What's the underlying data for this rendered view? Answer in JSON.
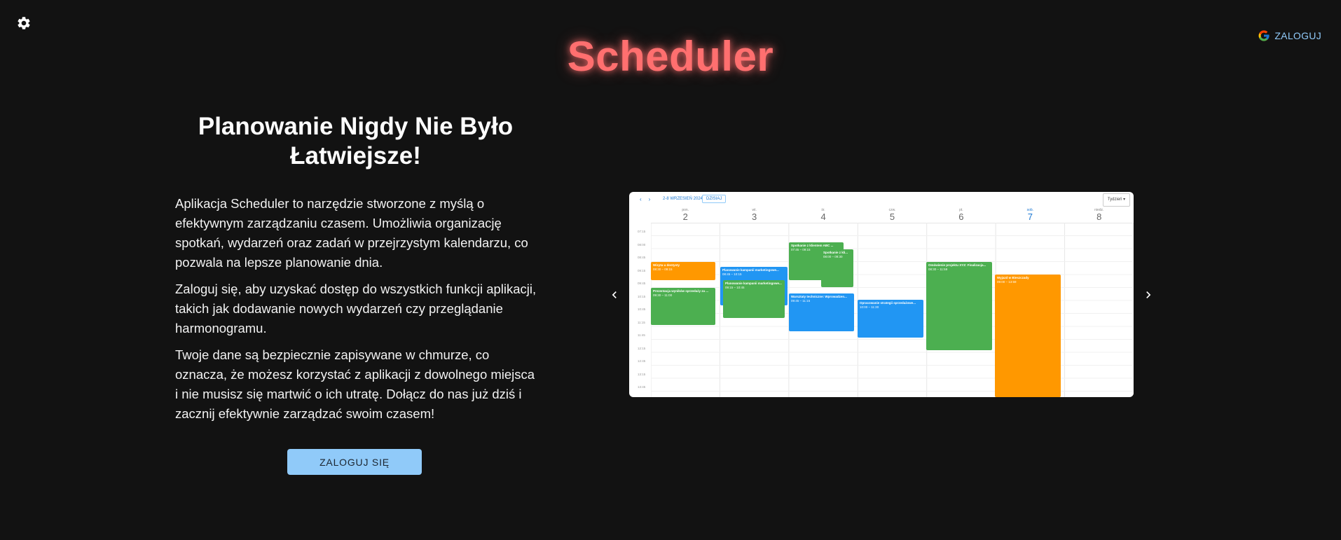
{
  "header": {
    "title": "Scheduler",
    "login_label": "ZALOGUJ",
    "settings_icon": "gear-icon",
    "google_icon": "google-icon"
  },
  "hero": {
    "headline_line1": "Planowanie Nigdy Nie Było",
    "headline_line2": "Łatwiejsze!",
    "paragraphs": [
      "Aplikacja Scheduler to narzędzie stworzone z myślą o efektywnym zarządzaniu czasem. Umożliwia organizację spotkań, wydarzeń oraz zadań w przejrzystym kalendarzu, co pozwala na lepsze planowanie dnia.",
      "Zaloguj się, aby uzyskać dostęp do wszystkich funkcji aplikacji, takich jak dodawanie nowych wydarzeń czy przeglądanie harmonogramu.",
      "Twoje dane są bezpiecznie zapisywane w chmurze, co oznacza, że możesz korzystać z aplikacji z dowolnego miejsca i nie musisz się martwić o ich utratę. Dołącz do nas już dziś i zacznij efektywnie zarządzać swoim czasem!"
    ],
    "login_button": "ZALOGUJ SIĘ"
  },
  "carousel": {
    "prev_icon": "chevron-left-icon",
    "next_icon": "chevron-right-icon",
    "preview": {
      "range_label": "2-8 WRZESIEŃ 2024",
      "today_label": "DZISIAJ",
      "view_label": "Tydzień",
      "days": [
        {
          "name": "pon.",
          "num": "2"
        },
        {
          "name": "wt.",
          "num": "3"
        },
        {
          "name": "śr.",
          "num": "4"
        },
        {
          "name": "czw.",
          "num": "5"
        },
        {
          "name": "pt.",
          "num": "6"
        },
        {
          "name": "sob.",
          "num": "7",
          "active": true
        },
        {
          "name": "niedz.",
          "num": "8"
        }
      ],
      "times": [
        "07:15",
        "08:00",
        "08:45",
        "09:15",
        "09:45",
        "10:15",
        "10:45",
        "11:15",
        "11:45",
        "12:15",
        "12:45",
        "13:15",
        "13:45"
      ],
      "colors": {
        "orange": "#ff9800",
        "green": "#4caf50",
        "blue": "#2196f3"
      },
      "events": [
        {
          "title": "Wizyta u dentysty",
          "time": "08:30 – 09:15",
          "color": "orange"
        },
        {
          "title": "Prezentacja wyników sprzedaży za ...",
          "time": "09:30 – 11:00",
          "color": "green"
        },
        {
          "title": "Planowanie kampanii marketingowe...",
          "time": "08:45 – 10:15",
          "color": "blue"
        },
        {
          "title": "Planowanie kampanii marketingowe...",
          "time": "09:15 – 10:45",
          "color": "green"
        },
        {
          "title": "Spotkanie z klientem ABC ...",
          "time": "07:45 – 09:15",
          "color": "green"
        },
        {
          "title": "Spotkanie z kli...",
          "time": "08:00 – 09:30",
          "color": "green"
        },
        {
          "title": "Warsztaty techniczne: Wprowadzen...",
          "time": "09:45 – 11:15",
          "color": "blue"
        },
        {
          "title": "Opracowanie strategii sprzedażowe...",
          "time": "10:00 – 11:30",
          "color": "blue"
        },
        {
          "title": "Omówienie projektu XYZ: Finalizacja...",
          "time": "08:30 – 11:59",
          "color": "green"
        },
        {
          "title": "Wyjazd w Bieszczady",
          "time": "09:00 – 13:59",
          "color": "orange"
        }
      ]
    }
  }
}
